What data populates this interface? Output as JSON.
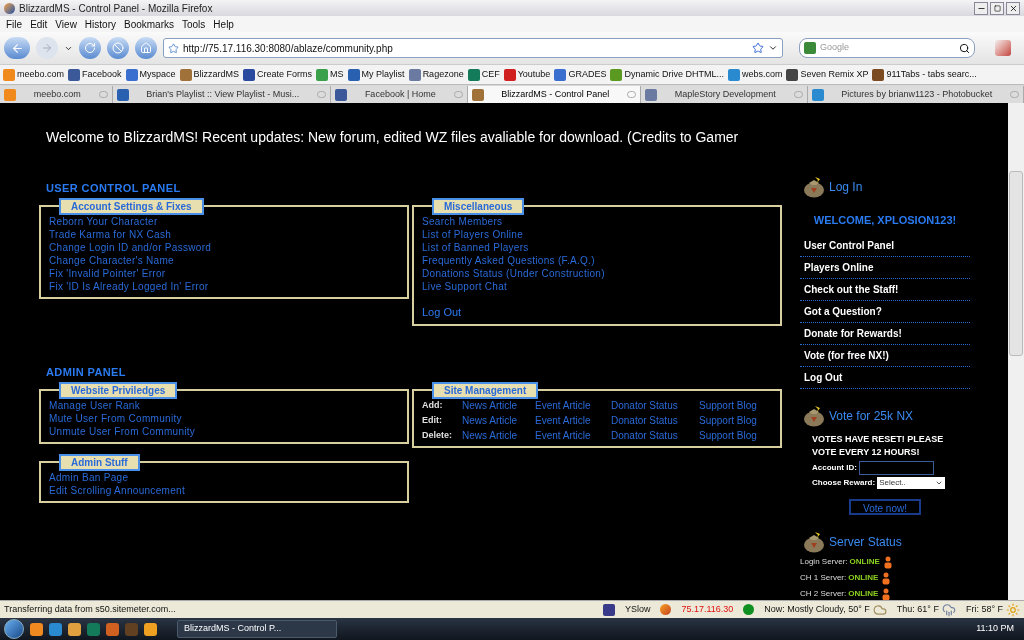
{
  "window": {
    "title": "BlizzardMS - Control Panel - Mozilla Firefox"
  },
  "menu": [
    "File",
    "Edit",
    "View",
    "History",
    "Bookmarks",
    "Tools",
    "Help"
  ],
  "toolbar": {
    "url": "http://75.17.116.30:8080/ablaze/community.php",
    "search_placeholder": "Google"
  },
  "bookmarks": [
    {
      "label": "meebo.com",
      "color": "#f08a1c"
    },
    {
      "label": "Facebook",
      "color": "#3b5998"
    },
    {
      "label": "Myspace",
      "color": "#3a6fd0"
    },
    {
      "label": "BlizzardMS",
      "color": "#a0723a"
    },
    {
      "label": "Create Forms",
      "color": "#2a4aa0"
    },
    {
      "label": "MS",
      "color": "#3aa04a"
    },
    {
      "label": "My Playlist",
      "color": "#2a60b0"
    },
    {
      "label": "Ragezone",
      "color": "#6a7aa0"
    },
    {
      "label": "CEF",
      "color": "#137a5a"
    },
    {
      "label": "Youtube",
      "color": "#d02020"
    },
    {
      "label": "GRADES",
      "color": "#3a6fd0"
    },
    {
      "label": "Dynamic Drive DHTML...",
      "color": "#5a9a20"
    },
    {
      "label": "webs.com",
      "color": "#2a8ad0"
    },
    {
      "label": "Seven Remix XP",
      "color": "#444444"
    },
    {
      "label": "911Tabs - tabs searc...",
      "color": "#7a4a20"
    }
  ],
  "tabs": [
    {
      "label": "meebo.com",
      "selected": false,
      "color": "#f08a1c"
    },
    {
      "label": "Brian's Playlist :: View Playlist - Musi...",
      "selected": false,
      "color": "#2a60b0"
    },
    {
      "label": "Facebook | Home",
      "selected": false,
      "color": "#3b5998"
    },
    {
      "label": "BlizzardMS - Control Panel",
      "selected": true,
      "color": "#a0723a"
    },
    {
      "label": "MapleStory Development",
      "selected": false,
      "color": "#6a7aa0"
    },
    {
      "label": "Pictures by brianw1123 - Photobucket",
      "selected": false,
      "color": "#2a8ad0"
    }
  ],
  "page": {
    "announcement": "Welcome to BlizzardMS! Recent updates: New forum, edited WZ files avaliable for download. (Credits to Gamer",
    "panels": [
      {
        "title": "USER CONTROL PANEL",
        "groups": [
          {
            "kind": "list",
            "title": "Account Settings & Fixes",
            "links": [
              "Reborn Your Character",
              "Trade Karma for NX Cash",
              "Change Login ID and/or Password",
              "Change Character's Name",
              "Fix 'Invalid Pointer' Error",
              "Fix 'ID Is Already Logged In' Error"
            ]
          },
          {
            "kind": "list",
            "title": "Miscellaneous",
            "links": [
              "Search Members",
              "List of Players Online",
              "List of Banned Players",
              "Frequently Asked Questions (F.A.Q.)",
              "Donations Status (Under Construction)",
              "Live Support Chat"
            ],
            "footer_link": "Log Out"
          }
        ]
      },
      {
        "title": "ADMIN PANEL",
        "groups": [
          {
            "kind": "list",
            "title": "Website Priviledges",
            "links": [
              "Manage User Rank",
              "Mute User From Community",
              "Unmute User From Community"
            ]
          },
          {
            "kind": "table",
            "title": "Site Management",
            "rows": [
              {
                "label": "Add:",
                "links": [
                  "News Article",
                  "Event Article",
                  "Donator Status",
                  "Support Blog"
                ]
              },
              {
                "label": "Edit:",
                "links": [
                  "News Article",
                  "Event Article",
                  "Donator Status",
                  "Support Blog"
                ]
              },
              {
                "label": "Delete:",
                "links": [
                  "News Article",
                  "Event Article",
                  "Donator Status",
                  "Support Blog"
                ]
              }
            ]
          },
          {
            "kind": "list",
            "title": "Admin Stuff",
            "links": [
              "Admin Ban Page",
              "Edit Scrolling Announcement"
            ]
          }
        ]
      }
    ],
    "sidebar": {
      "login": {
        "title": "Log In",
        "welcome": "WELCOME, XPLOSION123!",
        "links": [
          "User Control Panel",
          "Players Online",
          "Check out the Staff!",
          "Got a Question?",
          "Donate for Rewards!",
          "Vote (for free NX!)",
          "Log Out"
        ]
      },
      "vote": {
        "title": "Vote for 25k NX",
        "notice": "VOTES HAVE RESET! PLEASE VOTE EVERY 12 HOURS!",
        "fields": [
          {
            "kind": "text",
            "label": "Account ID:"
          },
          {
            "kind": "select",
            "label": "Choose Reward:",
            "value": "Select.."
          }
        ],
        "button": "Vote now!"
      },
      "server": {
        "title": "Server Status",
        "servers": [
          {
            "name": "Login Server:",
            "status": "ONLINE"
          },
          {
            "name": "CH 1 Server:",
            "status": "ONLINE"
          },
          {
            "name": "CH 2 Server:",
            "status": "ONLINE"
          }
        ]
      }
    }
  },
  "status_bar": {
    "message": "Transferring data from s50.sitemeter.com...",
    "yslow": "YSlow",
    "ip": "75.17.116.30",
    "weather": [
      "Now: Mostly Cloudy, 50° F",
      "Thu: 61° F",
      "Fri: 58° F"
    ]
  },
  "taskbar": {
    "window_button": "BlizzardMS - Control P...",
    "clock": "11:10 PM"
  }
}
